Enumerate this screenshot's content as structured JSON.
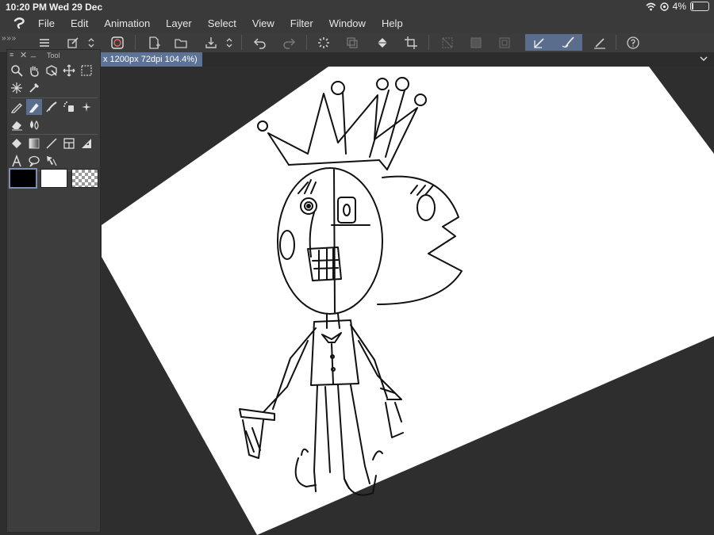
{
  "status": {
    "time": "10:20 PM",
    "date": "Wed 29 Dec",
    "battery": "4%"
  },
  "menu": {
    "items": [
      "File",
      "Edit",
      "Animation",
      "Layer",
      "Select",
      "View",
      "Filter",
      "Window",
      "Help"
    ]
  },
  "tool_panel": {
    "title": "Tool",
    "colors": {
      "main": "#000000",
      "sub": "#ffffff",
      "transparent": "transparent"
    }
  },
  "document": {
    "tab_label": "x 1200px 72dpi 104.4%)"
  },
  "colors": {
    "active_accent": "#5a6d8c",
    "tab_accent": "#5c7297",
    "canvas_paper": "#ffffff",
    "workspace": "#2e2e2e"
  }
}
